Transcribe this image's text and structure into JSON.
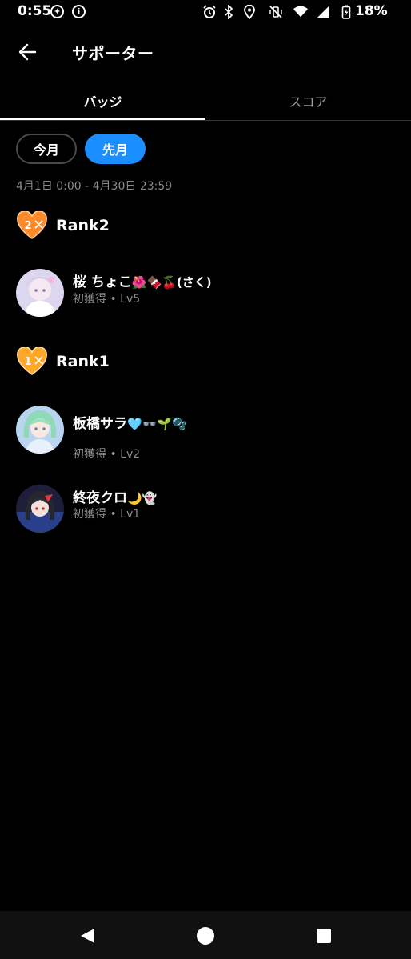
{
  "status_bar": {
    "time": "0:55",
    "battery_percent": "18%",
    "icons": [
      "game-controller-icon",
      "info-icon",
      "alarm-icon",
      "bluetooth-icon",
      "location-icon",
      "vibrate-off-icon",
      "wifi-icon",
      "signal-icon",
      "battery-charging-icon"
    ]
  },
  "header": {
    "title": "サポーター",
    "back_icon": "arrow-left-icon"
  },
  "tabs": [
    {
      "label": "バッジ",
      "active": true
    },
    {
      "label": "スコア",
      "active": false
    }
  ],
  "period": {
    "this_month_label": "今月",
    "last_month_label": "先月",
    "selected": "先月",
    "date_range": "4月1日 0:00 - 4月30日 23:59"
  },
  "colors": {
    "accent": "#1b8fff",
    "rank2_heart": "#ff8a2a",
    "rank1_heart": "#ffa726"
  },
  "ranks": [
    {
      "label": "Rank2",
      "badge_number": "2",
      "supporters": [
        {
          "name": "桜 ちょこ",
          "name_emojis": "🌺🍫🍒(さく)",
          "subtitle": "初獲得 • Lv5"
        }
      ]
    },
    {
      "label": "Rank1",
      "badge_number": "1",
      "supporters": [
        {
          "name": "板橋サラ",
          "name_emojis": "🩵👓🌱🫧",
          "subtitle": "初獲得 • Lv2"
        },
        {
          "name": "終夜クロ",
          "name_emojis": "🌙👻",
          "subtitle": "初獲得 • Lv1"
        }
      ]
    }
  ],
  "nav_bar": {
    "buttons": [
      "back-triangle-icon",
      "home-circle-icon",
      "recents-square-icon"
    ]
  }
}
